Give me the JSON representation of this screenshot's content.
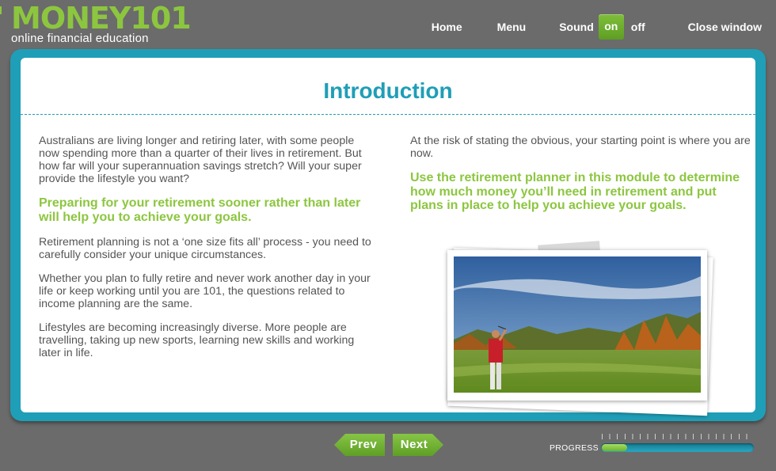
{
  "brand": {
    "name": "MONEY101",
    "tagline": "online financial education",
    "color": "#8cc63f"
  },
  "nav": {
    "home": "Home",
    "menu": "Menu",
    "sound_label": "Sound",
    "sound_on": "on",
    "sound_off": "off",
    "close": "Close window"
  },
  "page": {
    "title": "Introduction",
    "left": {
      "p1": "Australians are living longer and retiring later, with some people now spending more than a quarter of their lives in retirement. But how far will your superannuation savings stretch? Will your super provide the lifestyle you want?",
      "highlight": "Preparing for your retirement sooner rather than later will help you to achieve your goals.",
      "p2": "Retirement planning is not a ‘one size fits all’ process - you need to carefully consider your unique circumstances.",
      "p3": "Whether you plan to fully retire and never work another day in your life or keep working until you are 101, the questions related to income planning are the same.",
      "p4": "Lifestyles are becoming increasingly diverse. More people are travelling, taking up new sports, learning new skills and working later in life."
    },
    "right": {
      "p1": "At the risk of stating the obvious, your starting point is where you are now.",
      "highlight": "Use the retirement planner in this module to determine how much money you’ll need in retirement and put plans in place to help you achieve your goals."
    }
  },
  "footer": {
    "prev": "Prev",
    "next": "Next",
    "progress_label": "PROGRESS",
    "progress_fraction": 0.17
  },
  "colors": {
    "accent": "#1f9eb7",
    "highlight": "#8cc63f",
    "background": "#6b6b6b"
  }
}
